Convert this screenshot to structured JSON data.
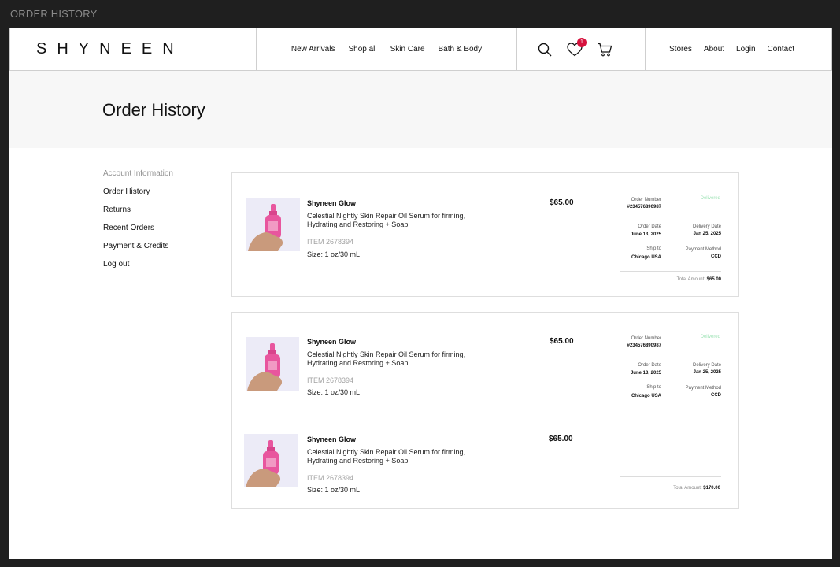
{
  "frame_title": "ORDER HISTORY",
  "header": {
    "logo": "SHYNEEN",
    "nav": [
      "New Arrivals",
      "Shop all",
      "Skin Care",
      "Bath & Body"
    ],
    "wishlist_count": "1",
    "icons": [
      "search-icon",
      "heart-icon",
      "cart-icon"
    ],
    "util": [
      "Stores",
      "About",
      "Login",
      "Contact"
    ]
  },
  "page_title": "Order History",
  "sidebar": {
    "heading": "Account Information",
    "items": [
      "Order History",
      "Returns",
      "Recent Orders",
      "Payment & Credits",
      "Log out"
    ]
  },
  "labels": {
    "order_number": "Order Number",
    "order_date": "Order Date",
    "delivery_date": "Delivery Date",
    "ship_to": "Ship to",
    "payment_method": "Payment Method",
    "total_amount": "Total Amount:"
  },
  "orders": [
    {
      "status": "Delivered",
      "order_number": "#234576890987",
      "order_date": "June 13, 2025",
      "delivery_date": "Jan 25, 2025",
      "ship_to": "Chicago USA",
      "payment_method": "CCD",
      "total": "$65.00",
      "items": [
        {
          "name": "Shyneen Glow",
          "desc": "Celestial Nightly Skin Repair Oil Serum for firming, Hydrating and Restoring + Soap",
          "sku": "ITEM 2678394",
          "size": "Size: 1 oz/30 mL",
          "price": "$65.00"
        }
      ]
    },
    {
      "status": "Delivered",
      "order_number": "#234576890987",
      "order_date": "June 13, 2025",
      "delivery_date": "Jan 25, 2025",
      "ship_to": "Chicago USA",
      "payment_method": "CCD",
      "total": "$170.00",
      "items": [
        {
          "name": "Shyneen Glow",
          "desc": "Celestial Nightly Skin Repair Oil Serum for firming, Hydrating and Restoring + Soap",
          "sku": "ITEM 2678394",
          "size": "Size: 1 oz/30 mL",
          "price": "$65.00"
        },
        {
          "name": "Shyneen Glow",
          "desc": "Celestial Nightly Skin Repair Oil Serum for firming, Hydrating and Restoring + Soap",
          "sku": "ITEM 2678394",
          "size": "Size: 1 oz/30 mL",
          "price": "$65.00"
        }
      ]
    }
  ],
  "colors": {
    "badge": "#d6123d",
    "status": "#9ee3b5",
    "hero_bg": "#f7f7f7",
    "product_pink": "#e8569e"
  }
}
